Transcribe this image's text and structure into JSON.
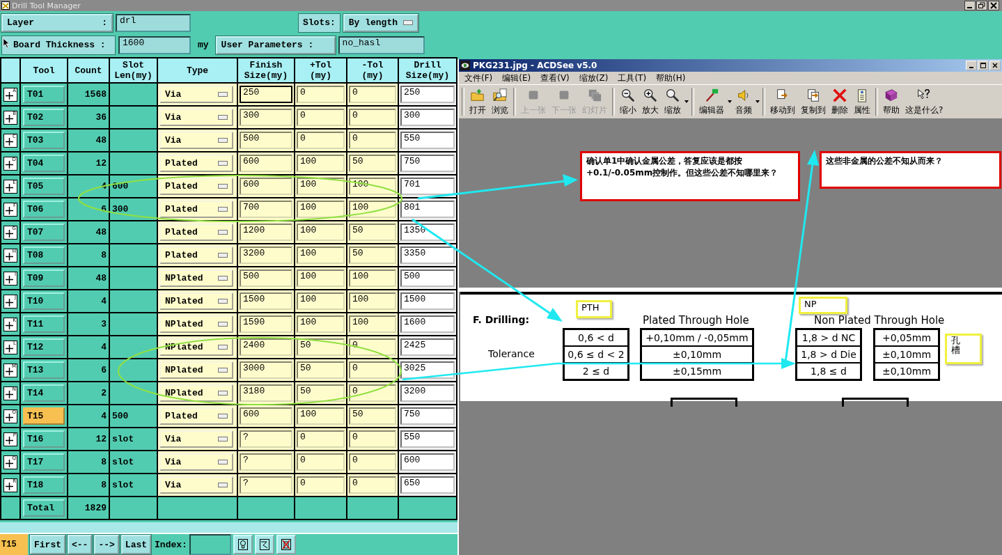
{
  "window": {
    "title": "Drill Tool Manager"
  },
  "layer": {
    "label": "Layer",
    "sep": ":",
    "value": "drl"
  },
  "slots": {
    "label": "Slots:",
    "value": "By length"
  },
  "board": {
    "label": "Board Thickness :",
    "value": "1600",
    "unit": "my"
  },
  "user_params": {
    "label": "User Parameters :",
    "value": "no_hasl"
  },
  "columns": [
    "Tool",
    "Count",
    "Slot Len(my)",
    "Type",
    "Finish Size(my)",
    "+Tol (my)",
    "-Tol (my)",
    "Drill Size(my)"
  ],
  "rows": [
    {
      "mark": "A",
      "tool": "T01",
      "count": "1568",
      "slot": "",
      "type": "Via",
      "finish": "250",
      "ptol": "0",
      "ntol": "0",
      "drill": "250",
      "selected": false,
      "focused": true
    },
    {
      "mark": "B",
      "tool": "T02",
      "count": "36",
      "slot": "",
      "type": "Via",
      "finish": "300",
      "ptol": "0",
      "ntol": "0",
      "drill": "300",
      "selected": false,
      "focused": false
    },
    {
      "mark": "C",
      "tool": "T03",
      "count": "48",
      "slot": "",
      "type": "Via",
      "finish": "500",
      "ptol": "0",
      "ntol": "0",
      "drill": "550",
      "selected": false,
      "focused": false
    },
    {
      "mark": "D",
      "tool": "T04",
      "count": "12",
      "slot": "",
      "type": "Plated",
      "finish": "600",
      "ptol": "100",
      "ntol": "50",
      "drill": "750",
      "selected": false,
      "focused": false
    },
    {
      "mark": "E",
      "tool": "T05",
      "count": "4",
      "slot": "600",
      "type": "Plated",
      "finish": "600",
      "ptol": "100",
      "ntol": "100",
      "drill": "701",
      "selected": false,
      "focused": false
    },
    {
      "mark": "F",
      "tool": "T06",
      "count": "6",
      "slot": "300",
      "type": "Plated",
      "finish": "700",
      "ptol": "100",
      "ntol": "100",
      "drill": "801",
      "selected": false,
      "focused": false
    },
    {
      "mark": "G",
      "tool": "T07",
      "count": "48",
      "slot": "",
      "type": "Plated",
      "finish": "1200",
      "ptol": "100",
      "ntol": "50",
      "drill": "1350",
      "selected": false,
      "focused": false
    },
    {
      "mark": "H",
      "tool": "T08",
      "count": "8",
      "slot": "",
      "type": "Plated",
      "finish": "3200",
      "ptol": "100",
      "ntol": "50",
      "drill": "3350",
      "selected": false,
      "focused": false
    },
    {
      "mark": "I",
      "tool": "T09",
      "count": "48",
      "slot": "",
      "type": "NPlated",
      "finish": "500",
      "ptol": "100",
      "ntol": "100",
      "drill": "500",
      "selected": false,
      "focused": false
    },
    {
      "mark": "J",
      "tool": "T10",
      "count": "4",
      "slot": "",
      "type": "NPlated",
      "finish": "1500",
      "ptol": "100",
      "ntol": "100",
      "drill": "1500",
      "selected": false,
      "focused": false
    },
    {
      "mark": "K",
      "tool": "T11",
      "count": "3",
      "slot": "",
      "type": "NPlated",
      "finish": "1590",
      "ptol": "100",
      "ntol": "100",
      "drill": "1600",
      "selected": false,
      "focused": false
    },
    {
      "mark": "L",
      "tool": "T12",
      "count": "4",
      "slot": "",
      "type": "NPlated",
      "finish": "2400",
      "ptol": "50",
      "ntol": "0",
      "drill": "2425",
      "selected": false,
      "focused": false
    },
    {
      "mark": "M",
      "tool": "T13",
      "count": "6",
      "slot": "",
      "type": "NPlated",
      "finish": "3000",
      "ptol": "50",
      "ntol": "0",
      "drill": "3025",
      "selected": false,
      "focused": false
    },
    {
      "mark": "N",
      "tool": "T14",
      "count": "2",
      "slot": "",
      "type": "NPlated",
      "finish": "3180",
      "ptol": "50",
      "ntol": "0",
      "drill": "3200",
      "selected": false,
      "focused": false
    },
    {
      "mark": "O",
      "tool": "T15",
      "count": "4",
      "slot": "500",
      "type": "Plated",
      "finish": "600",
      "ptol": "100",
      "ntol": "50",
      "drill": "750",
      "selected": true,
      "focused": false
    },
    {
      "mark": "P",
      "tool": "T16",
      "count": "12",
      "slot": "slot",
      "type": "Via",
      "finish": "?",
      "ptol": "0",
      "ntol": "0",
      "drill": "550",
      "selected": false,
      "focused": false
    },
    {
      "mark": "Q",
      "tool": "T17",
      "count": "8",
      "slot": "slot",
      "type": "Via",
      "finish": "?",
      "ptol": "0",
      "ntol": "0",
      "drill": "600",
      "selected": false,
      "focused": false
    },
    {
      "mark": "R",
      "tool": "T18",
      "count": "8",
      "slot": "slot",
      "type": "Via",
      "finish": "?",
      "ptol": "0",
      "ntol": "0",
      "drill": "650",
      "selected": false,
      "focused": false
    }
  ],
  "total": {
    "label": "Total",
    "count": "1829"
  },
  "navigator": {
    "current": "T15",
    "buttons": [
      "First",
      "<--",
      "-->",
      "Last"
    ],
    "index_label": "Index:"
  },
  "viewer": {
    "title": "PKG231.jpg - ACDSee v5.0",
    "menu": [
      "文件(F)",
      "编辑(E)",
      "查看(V)",
      "缩放(Z)",
      "工具(T)",
      "帮助(H)"
    ],
    "toolbar": [
      {
        "items": [
          {
            "kind": "open",
            "label": "打开",
            "disabled": false,
            "dropdown": false
          },
          {
            "kind": "browse",
            "label": "浏览",
            "disabled": false,
            "dropdown": false
          }
        ]
      },
      {
        "items": [
          {
            "kind": "prev",
            "label": "上一张",
            "disabled": true,
            "dropdown": false
          },
          {
            "kind": "next",
            "label": "下一张",
            "disabled": true,
            "dropdown": false
          },
          {
            "kind": "slides",
            "label": "幻灯片",
            "disabled": true,
            "dropdown": false
          }
        ]
      },
      {
        "items": [
          {
            "kind": "zoomout",
            "label": "缩小",
            "disabled": false,
            "dropdown": false
          },
          {
            "kind": "zoomin",
            "label": "放大",
            "disabled": false,
            "dropdown": false
          },
          {
            "kind": "zoom",
            "label": "缩放",
            "disabled": false,
            "dropdown": true
          }
        ]
      },
      {
        "items": [
          {
            "kind": "editor",
            "label": "编辑器",
            "disabled": false,
            "dropdown": true
          },
          {
            "kind": "audio",
            "label": "音频",
            "disabled": false,
            "dropdown": true
          }
        ]
      },
      {
        "items": [
          {
            "kind": "move",
            "label": "移动到",
            "disabled": false,
            "dropdown": false
          },
          {
            "kind": "copy",
            "label": "复制到",
            "disabled": false,
            "dropdown": false
          },
          {
            "kind": "delete",
            "label": "删除",
            "disabled": false,
            "dropdown": false
          },
          {
            "kind": "props",
            "label": "属性",
            "disabled": false,
            "dropdown": false
          }
        ]
      },
      {
        "items": [
          {
            "kind": "help",
            "label": "帮助",
            "disabled": false,
            "dropdown": false
          },
          {
            "kind": "what",
            "label": "这是什么?",
            "disabled": false,
            "dropdown": false
          }
        ]
      }
    ],
    "notes": [
      "确认单1中确认金属公差，答复应该是都按+0.1/-0.05mm控制作。但这些公差不知哪里来？",
      "这些非金属的公差不知从而来？"
    ],
    "document": {
      "section": "F. Drilling:",
      "row_label": "Tolerance",
      "pth_tag": "PTH",
      "np_tag": "NP",
      "side_tag": "孔槽",
      "pth_title": "Plated Through Hole",
      "np_title": "Non Plated Through Hole",
      "pth": [
        [
          "0,6 < d",
          "+0,10mm / -0,05mm"
        ],
        [
          "0,6 ≤ d < 2",
          "±0,10mm"
        ],
        [
          "2 ≤ d",
          "±0,15mm"
        ]
      ],
      "np": [
        [
          "1,8 > d NC",
          "+0,05mm"
        ],
        [
          "1,8 > d Die",
          "±0,10mm"
        ],
        [
          "1,8 ≤ d",
          "±0,10mm"
        ]
      ]
    }
  }
}
